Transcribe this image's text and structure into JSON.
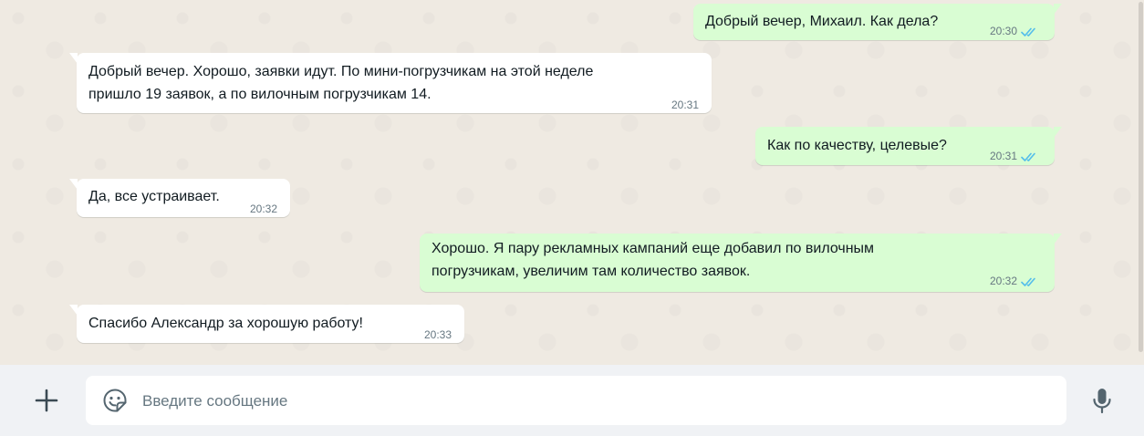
{
  "messages": [
    {
      "direction": "out",
      "text": "Добрый вечер, Михаил. Как дела?",
      "time": "20:30",
      "status": "read"
    },
    {
      "direction": "in",
      "text": "Добрый вечер. Хорошо, заявки идут. По мини-погрузчикам на этой неделе\nпришло 19 заявок, а по вилочным погрузчикам 14.",
      "time": "20:31"
    },
    {
      "direction": "out",
      "text": "Как по качеству, целевые?",
      "time": "20:31",
      "status": "read"
    },
    {
      "direction": "in",
      "text": "Да, все устраивает.",
      "time": "20:32"
    },
    {
      "direction": "out",
      "text": "Хорошо. Я пару рекламных кампаний еще добавил по вилочным\nпогрузчикам, увеличим там количество заявок.",
      "time": "20:32",
      "status": "read"
    },
    {
      "direction": "in",
      "text": "Спасибо Александр за хорошую работу!",
      "time": "20:33"
    }
  ],
  "composer": {
    "placeholder": "Введите сообщение",
    "value": ""
  },
  "icons": {
    "attach": "plus-icon",
    "emoji": "sticker-smiley-icon",
    "voice": "microphone-icon",
    "read_receipt": "double-check-icon"
  },
  "colors": {
    "chat_background": "#efeae2",
    "incoming_bubble": "#ffffff",
    "outgoing_bubble": "#d9fdd3",
    "read_check": "#53bdeb",
    "meta_text": "#667781",
    "composer_background": "#f0f2f5"
  }
}
